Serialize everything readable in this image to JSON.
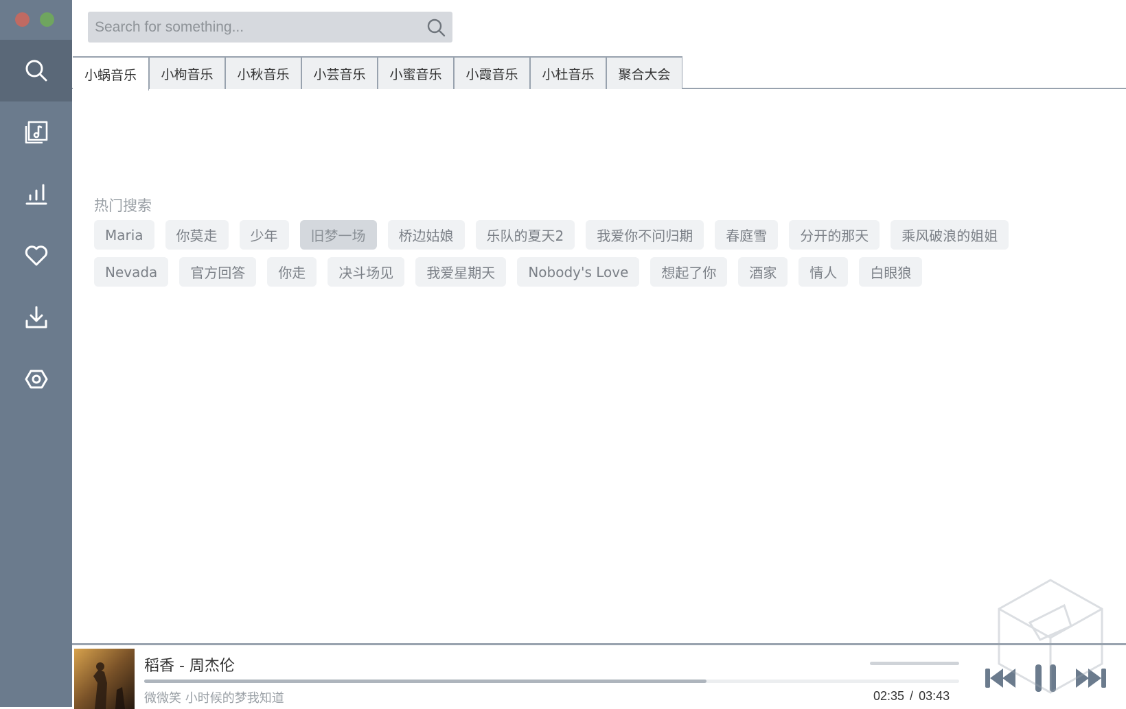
{
  "search": {
    "placeholder": "Search for something..."
  },
  "sidebar": {
    "items": [
      {
        "icon": "search-icon"
      },
      {
        "icon": "music-playlist-icon"
      },
      {
        "icon": "chart-bars-icon"
      },
      {
        "icon": "heart-icon"
      },
      {
        "icon": "download-icon"
      },
      {
        "icon": "settings-icon"
      }
    ]
  },
  "tabs": [
    {
      "label": "小蜗音乐",
      "active": true
    },
    {
      "label": "小枸音乐"
    },
    {
      "label": "小秋音乐"
    },
    {
      "label": "小芸音乐"
    },
    {
      "label": "小蜜音乐"
    },
    {
      "label": "小霞音乐"
    },
    {
      "label": "小杜音乐"
    },
    {
      "label": "聚合大会"
    }
  ],
  "hot": {
    "title": "热门搜索",
    "row1": [
      "Maria",
      "你莫走",
      "少年",
      "旧梦一场",
      "桥边姑娘",
      "乐队的夏天2",
      "我爱你不问归期",
      "春庭雪",
      "分开的那天",
      "乘风破浪的姐姐"
    ],
    "row2": [
      "Nevada",
      "官方回答",
      "你走",
      "决斗场见",
      "我爱星期天",
      "Nobody's Love",
      "想起了你",
      "酒家",
      "情人",
      "白眼狼"
    ],
    "selected": "旧梦一场"
  },
  "player": {
    "title": "稻香 - 周杰伦",
    "lyric": "微微笑 小时候的梦我知道",
    "current_time": "02:35",
    "separator": "/",
    "total_time": "03:43",
    "progress_fraction": 0.69
  },
  "colors": {
    "sidebar": "#6b7b8d",
    "sidebar_active": "#5a6878",
    "tab_border": "#98a2ae",
    "tag_bg": "#f0f2f4"
  }
}
